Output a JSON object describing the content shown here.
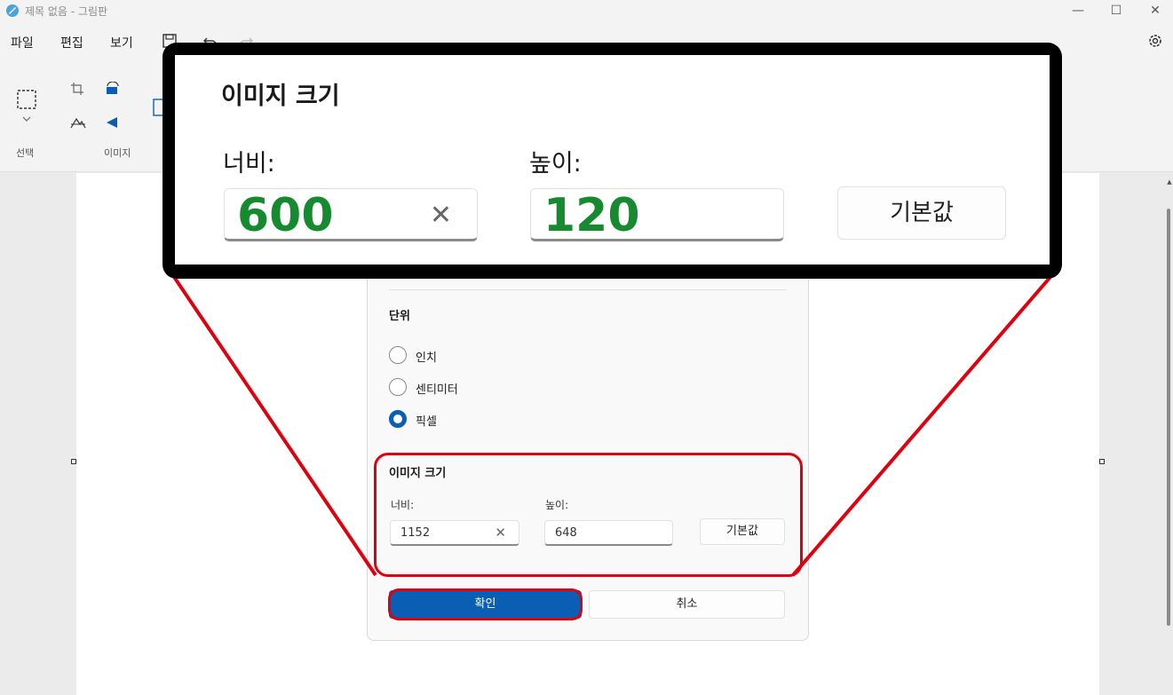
{
  "window": {
    "title": "제목 없음 - 그림판",
    "min_label": "—",
    "max_label": "☐",
    "close_label": "✕"
  },
  "menu": {
    "file": "파일",
    "edit": "편집",
    "view": "보기"
  },
  "ribbon": {
    "select_label": "선택",
    "image_label": "이미지"
  },
  "dialog": {
    "units_title": "단위",
    "units": [
      {
        "label": "인치",
        "checked": false
      },
      {
        "label": "센티미터",
        "checked": false
      },
      {
        "label": "픽셀",
        "checked": true
      }
    ],
    "image_size_title": "이미지 크기",
    "width_label": "너비:",
    "height_label": "높이:",
    "width_value": "1152",
    "height_value": "648",
    "default_button": "기본값",
    "ok_button": "확인",
    "cancel_button": "취소"
  },
  "zoom": {
    "title": "이미지 크기",
    "width_label": "너비:",
    "height_label": "높이:",
    "width_value": "600",
    "height_value": "120",
    "default_button": "기본값"
  },
  "colors": {
    "accent": "#0a5fb4",
    "highlight": "#e0000e",
    "zoom_value": "#168a2e"
  }
}
